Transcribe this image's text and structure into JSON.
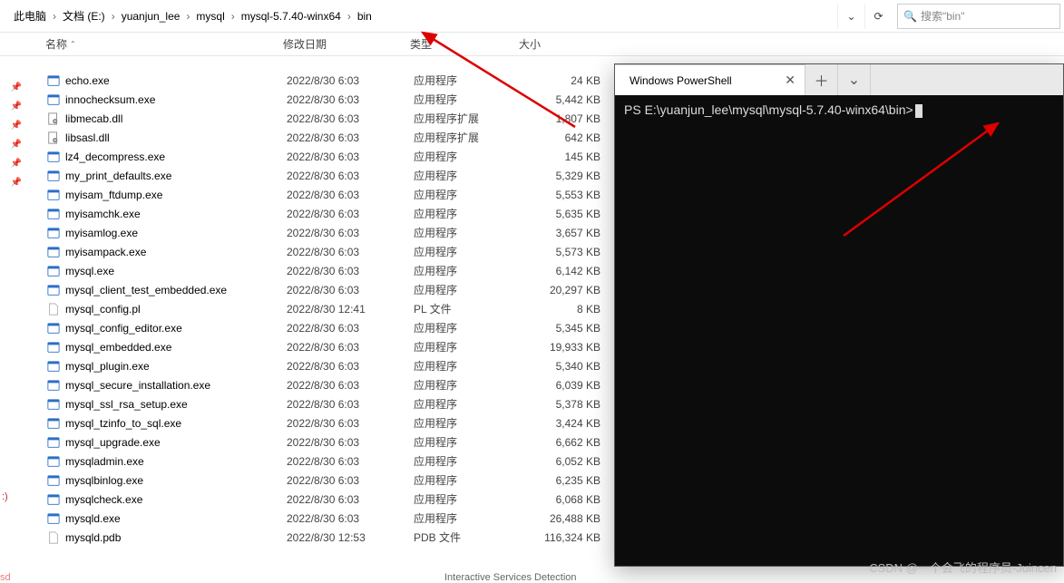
{
  "breadcrumbs": [
    "此电脑",
    "文档 (E:)",
    "yuanjun_lee",
    "mysql",
    "mysql-5.7.40-winx64",
    "bin"
  ],
  "search": {
    "placeholder": "搜索\"bin\""
  },
  "headers": {
    "name": "名称",
    "date": "修改日期",
    "type": "类型",
    "size": "大小"
  },
  "sidebar": {
    "drive": ":)"
  },
  "icon_names": {
    "exe": "exe-icon",
    "dll": "dll-icon",
    "file": "file-icon"
  },
  "files": [
    {
      "name": "echo.exe",
      "date": "2022/8/30 6:03",
      "type": "应用程序",
      "size": "24 KB",
      "icon": "exe"
    },
    {
      "name": "innochecksum.exe",
      "date": "2022/8/30 6:03",
      "type": "应用程序",
      "size": "5,442 KB",
      "icon": "exe"
    },
    {
      "name": "libmecab.dll",
      "date": "2022/8/30 6:03",
      "type": "应用程序扩展",
      "size": "1,807 KB",
      "icon": "dll"
    },
    {
      "name": "libsasl.dll",
      "date": "2022/8/30 6:03",
      "type": "应用程序扩展",
      "size": "642 KB",
      "icon": "dll"
    },
    {
      "name": "lz4_decompress.exe",
      "date": "2022/8/30 6:03",
      "type": "应用程序",
      "size": "145 KB",
      "icon": "exe"
    },
    {
      "name": "my_print_defaults.exe",
      "date": "2022/8/30 6:03",
      "type": "应用程序",
      "size": "5,329 KB",
      "icon": "exe"
    },
    {
      "name": "myisam_ftdump.exe",
      "date": "2022/8/30 6:03",
      "type": "应用程序",
      "size": "5,553 KB",
      "icon": "exe"
    },
    {
      "name": "myisamchk.exe",
      "date": "2022/8/30 6:03",
      "type": "应用程序",
      "size": "5,635 KB",
      "icon": "exe"
    },
    {
      "name": "myisamlog.exe",
      "date": "2022/8/30 6:03",
      "type": "应用程序",
      "size": "3,657 KB",
      "icon": "exe"
    },
    {
      "name": "myisampack.exe",
      "date": "2022/8/30 6:03",
      "type": "应用程序",
      "size": "5,573 KB",
      "icon": "exe"
    },
    {
      "name": "mysql.exe",
      "date": "2022/8/30 6:03",
      "type": "应用程序",
      "size": "6,142 KB",
      "icon": "exe"
    },
    {
      "name": "mysql_client_test_embedded.exe",
      "date": "2022/8/30 6:03",
      "type": "应用程序",
      "size": "20,297 KB",
      "icon": "exe"
    },
    {
      "name": "mysql_config.pl",
      "date": "2022/8/30 12:41",
      "type": "PL 文件",
      "size": "8 KB",
      "icon": "file"
    },
    {
      "name": "mysql_config_editor.exe",
      "date": "2022/8/30 6:03",
      "type": "应用程序",
      "size": "5,345 KB",
      "icon": "exe"
    },
    {
      "name": "mysql_embedded.exe",
      "date": "2022/8/30 6:03",
      "type": "应用程序",
      "size": "19,933 KB",
      "icon": "exe"
    },
    {
      "name": "mysql_plugin.exe",
      "date": "2022/8/30 6:03",
      "type": "应用程序",
      "size": "5,340 KB",
      "icon": "exe"
    },
    {
      "name": "mysql_secure_installation.exe",
      "date": "2022/8/30 6:03",
      "type": "应用程序",
      "size": "6,039 KB",
      "icon": "exe"
    },
    {
      "name": "mysql_ssl_rsa_setup.exe",
      "date": "2022/8/30 6:03",
      "type": "应用程序",
      "size": "5,378 KB",
      "icon": "exe"
    },
    {
      "name": "mysql_tzinfo_to_sql.exe",
      "date": "2022/8/30 6:03",
      "type": "应用程序",
      "size": "3,424 KB",
      "icon": "exe"
    },
    {
      "name": "mysql_upgrade.exe",
      "date": "2022/8/30 6:03",
      "type": "应用程序",
      "size": "6,662 KB",
      "icon": "exe"
    },
    {
      "name": "mysqladmin.exe",
      "date": "2022/8/30 6:03",
      "type": "应用程序",
      "size": "6,052 KB",
      "icon": "exe"
    },
    {
      "name": "mysqlbinlog.exe",
      "date": "2022/8/30 6:03",
      "type": "应用程序",
      "size": "6,235 KB",
      "icon": "exe"
    },
    {
      "name": "mysqlcheck.exe",
      "date": "2022/8/30 6:03",
      "type": "应用程序",
      "size": "6,068 KB",
      "icon": "exe"
    },
    {
      "name": "mysqld.exe",
      "date": "2022/8/30 6:03",
      "type": "应用程序",
      "size": "26,488 KB",
      "icon": "exe"
    },
    {
      "name": "mysqld.pdb",
      "date": "2022/8/30 12:53",
      "type": "PDB 文件",
      "size": "116,324 KB",
      "icon": "file"
    }
  ],
  "terminal": {
    "tab_title": "Windows PowerShell",
    "prompt": "PS E:\\yuanjun_lee\\mysql\\mysql-5.7.40-winx64\\bin>"
  },
  "watermark": "CSDN @一个会飞的程序员-Juincen",
  "footer_text": "Interactive Services Detection",
  "corner_text": "sd"
}
